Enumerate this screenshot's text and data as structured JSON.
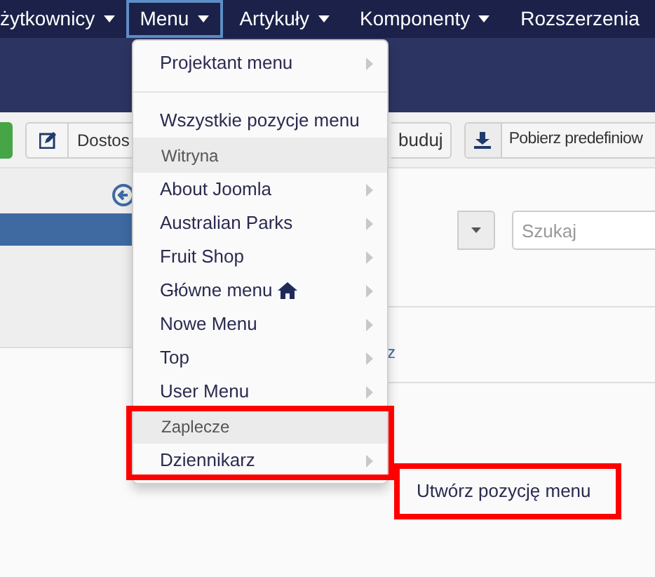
{
  "navbar": [
    {
      "label": "żytkownicy",
      "selected": false
    },
    {
      "label": "Menu",
      "selected": true
    },
    {
      "label": "Artykuły",
      "selected": false
    },
    {
      "label": "Komponenty",
      "selected": false
    },
    {
      "label": "Rozszerzenia",
      "selected": false
    }
  ],
  "toolbar": {
    "button_1": "Dostos",
    "button_2": "buduj",
    "button_3": "Pobierz predefiniow"
  },
  "search": {
    "placeholder": "Szukaj"
  },
  "content_link": "z",
  "dropdown": [
    {
      "divider_after": true,
      "highlighted": false,
      "items": [
        {
          "label": "Projektant menu",
          "has_submenu": true,
          "home": false
        }
      ]
    },
    {
      "divider_after": false,
      "highlighted": false,
      "items": [
        {
          "label": "Wszystkie pozycje menu",
          "has_submenu": false,
          "home": false
        }
      ]
    },
    {
      "header": "Witryna",
      "divider_after": false,
      "highlighted": false,
      "items": [
        {
          "label": "About Joomla",
          "has_submenu": true,
          "home": false
        },
        {
          "label": "Australian Parks",
          "has_submenu": true,
          "home": false
        },
        {
          "label": "Fruit Shop",
          "has_submenu": true,
          "home": false
        },
        {
          "label": "Główne menu",
          "has_submenu": true,
          "home": true
        },
        {
          "label": "Nowe Menu",
          "has_submenu": true,
          "home": false
        },
        {
          "label": "Top",
          "has_submenu": true,
          "home": false
        },
        {
          "label": "User Menu",
          "has_submenu": true,
          "home": false
        }
      ]
    },
    {
      "header": "Zaplecze",
      "divider_after": false,
      "highlighted": true,
      "items": [
        {
          "label": "Dziennikarz",
          "has_submenu": true,
          "home": false
        }
      ]
    }
  ],
  "submenu": {
    "items": [
      "Utwórz pozycję menu"
    ],
    "highlighted": true
  }
}
